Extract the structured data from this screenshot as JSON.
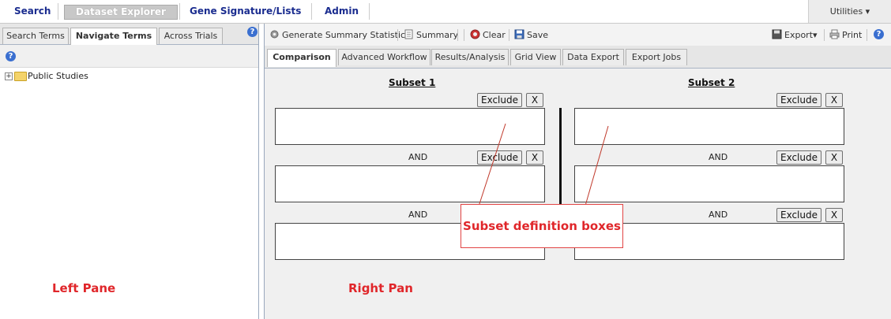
{
  "topnav": {
    "items": [
      "Search",
      "Dataset Explorer",
      "Gene Signature/Lists",
      "Admin"
    ],
    "utilities": "Utilities ▾"
  },
  "left": {
    "tabs": [
      "Search Terms",
      "Navigate Terms",
      "Across Trials"
    ],
    "active_tab": "Navigate Terms",
    "tree": {
      "root_label": "Public Studies",
      "expander": "+"
    },
    "annotation": "Left Pane"
  },
  "right": {
    "toolbar": {
      "summary_stats": "Generate Summary Statistics",
      "summary": "Summary",
      "clear": "Clear",
      "save": "Save",
      "export": "Export▾",
      "print": "Print"
    },
    "tabs": [
      "Comparison",
      "Advanced Workflow",
      "Results/Analysis",
      "Grid View",
      "Data Export",
      "Export Jobs"
    ],
    "active_tab": "Comparison",
    "subset1_title": "Subset 1",
    "subset2_title": "Subset 2",
    "exclude_label": "Exclude",
    "remove_label": "X",
    "and_label": "AND",
    "annotation": "Right Pan",
    "callout": "Subset definition boxes"
  },
  "colors": {
    "nav_text": "#1a2c8f",
    "annotation": "#e0262a",
    "help": "#3a6fd0"
  }
}
